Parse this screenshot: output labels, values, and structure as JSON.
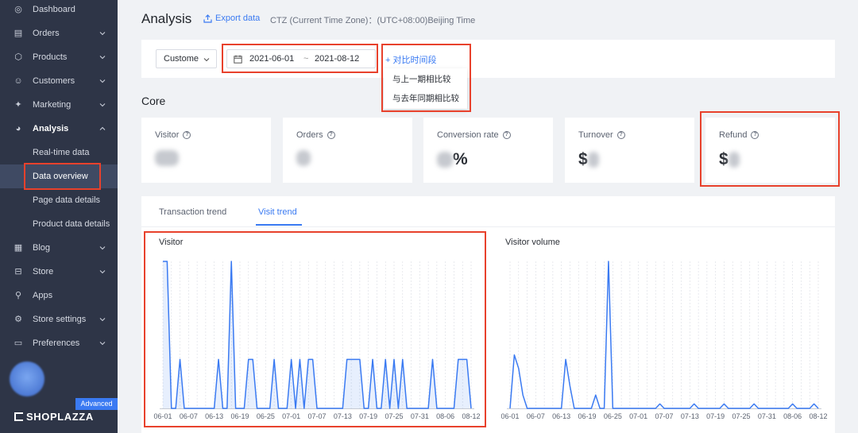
{
  "sidebar": {
    "items": [
      {
        "label": "Dashboard",
        "icon": "dashboard-icon",
        "has_chevron": false
      },
      {
        "label": "Orders",
        "icon": "orders-icon",
        "has_chevron": true
      },
      {
        "label": "Products",
        "icon": "products-icon",
        "has_chevron": true
      },
      {
        "label": "Customers",
        "icon": "customers-icon",
        "has_chevron": true
      },
      {
        "label": "Marketing",
        "icon": "marketing-icon",
        "has_chevron": true
      },
      {
        "label": "Analysis",
        "icon": "analysis-icon",
        "has_chevron": true,
        "expanded": true
      },
      {
        "label": "Blog",
        "icon": "blog-icon",
        "has_chevron": true
      },
      {
        "label": "Store",
        "icon": "store-icon",
        "has_chevron": true
      },
      {
        "label": "Apps",
        "icon": "apps-icon",
        "has_chevron": false
      },
      {
        "label": "Store settings",
        "icon": "gear-icon",
        "has_chevron": true
      },
      {
        "label": "Preferences",
        "icon": "preferences-icon",
        "has_chevron": true
      }
    ],
    "analysis_sub": [
      "Real-time data",
      "Data overview",
      "Page data details",
      "Product data details"
    ],
    "selected_sub": "Data overview",
    "badge": "Advanced",
    "logo": "SHOPLAZZA"
  },
  "header": {
    "title": "Analysis",
    "export_label": "Export data",
    "timezone": "CTZ (Current Time Zone)：(UTC+08:00)Beijing Time"
  },
  "filter": {
    "select_value": "Custome",
    "date_start": "2021-06-01",
    "date_sep": "~",
    "date_end": "2021-08-12",
    "compare_label": "+ 对比时间段",
    "compare_options": [
      "与上一期相比较",
      "与去年同期相比较"
    ]
  },
  "core": {
    "title": "Core",
    "metrics": [
      {
        "label": "Visitor",
        "prefix": "",
        "suffix": ""
      },
      {
        "label": "Orders",
        "prefix": "",
        "suffix": ""
      },
      {
        "label": "Conversion rate",
        "prefix": "",
        "suffix": "%"
      },
      {
        "label": "Turnover",
        "prefix": "$",
        "suffix": ""
      },
      {
        "label": "Refund",
        "prefix": "$",
        "suffix": ""
      }
    ]
  },
  "tabs": [
    {
      "label": "Transaction trend",
      "active": false
    },
    {
      "label": "Visit trend",
      "active": true
    }
  ],
  "chart_data": [
    {
      "type": "area",
      "title": "Visitor",
      "x": [
        "06-01",
        "06-02",
        "06-03",
        "06-04",
        "06-05",
        "06-06",
        "06-07",
        "06-08",
        "06-09",
        "06-10",
        "06-11",
        "06-12",
        "06-13",
        "06-14",
        "06-15",
        "06-16",
        "06-17",
        "06-18",
        "06-19",
        "06-20",
        "06-21",
        "06-22",
        "06-23",
        "06-24",
        "06-25",
        "06-26",
        "06-27",
        "06-28",
        "06-29",
        "06-30",
        "07-01",
        "07-02",
        "07-03",
        "07-04",
        "07-05",
        "07-06",
        "07-07",
        "07-08",
        "07-09",
        "07-10",
        "07-11",
        "07-12",
        "07-13",
        "07-14",
        "07-15",
        "07-16",
        "07-17",
        "07-18",
        "07-19",
        "07-20",
        "07-21",
        "07-22",
        "07-23",
        "07-24",
        "07-25",
        "07-26",
        "07-27",
        "07-28",
        "07-29",
        "07-30",
        "07-31",
        "08-01",
        "08-02",
        "08-03",
        "08-04",
        "08-05",
        "08-06",
        "08-07",
        "08-08",
        "08-09",
        "08-10",
        "08-11",
        "08-12"
      ],
      "tick_labels": [
        "06-01",
        "06-07",
        "06-13",
        "06-19",
        "06-25",
        "07-01",
        "07-07",
        "07-13",
        "07-19",
        "07-25",
        "07-31",
        "08-06",
        "08-12"
      ],
      "series": [
        {
          "values": [
            3,
            3,
            0,
            0,
            1,
            0,
            0,
            0,
            0,
            0,
            0,
            0,
            0,
            1,
            0,
            0,
            3,
            0,
            0,
            0,
            1,
            1,
            0,
            0,
            0,
            0,
            1,
            0,
            0,
            0,
            1,
            0,
            1,
            0,
            1,
            1,
            0,
            0,
            0,
            0,
            0,
            0,
            0,
            1,
            1,
            1,
            1,
            0,
            0,
            1,
            0,
            0,
            1,
            0,
            1,
            0,
            1,
            0,
            0,
            0,
            0,
            0,
            0,
            1,
            0,
            0,
            0,
            0,
            0,
            1,
            1,
            1,
            0
          ]
        }
      ],
      "grid": true
    },
    {
      "type": "line",
      "title": "Visitor volume",
      "x": [
        "06-01",
        "06-02",
        "06-03",
        "06-04",
        "06-05",
        "06-06",
        "06-07",
        "06-08",
        "06-09",
        "06-10",
        "06-11",
        "06-12",
        "06-13",
        "06-14",
        "06-15",
        "06-16",
        "06-17",
        "06-18",
        "06-19",
        "06-20",
        "06-21",
        "06-22",
        "06-23",
        "06-24",
        "06-25",
        "06-26",
        "06-27",
        "06-28",
        "06-29",
        "06-30",
        "07-01",
        "07-02",
        "07-03",
        "07-04",
        "07-05",
        "07-06",
        "07-07",
        "07-08",
        "07-09",
        "07-10",
        "07-11",
        "07-12",
        "07-13",
        "07-14",
        "07-15",
        "07-16",
        "07-17",
        "07-18",
        "07-19",
        "07-20",
        "07-21",
        "07-22",
        "07-23",
        "07-24",
        "07-25",
        "07-26",
        "07-27",
        "07-28",
        "07-29",
        "07-30",
        "07-31",
        "08-01",
        "08-02",
        "08-03",
        "08-04",
        "08-05",
        "08-06",
        "08-07",
        "08-08",
        "08-09",
        "08-10",
        "08-11",
        "08-12"
      ],
      "tick_labels": [
        "06-01",
        "06-07",
        "06-13",
        "06-19",
        "06-25",
        "07-01",
        "07-07",
        "07-13",
        "07-19",
        "07-25",
        "07-31",
        "08-06",
        "08-12"
      ],
      "series": [
        {
          "values": [
            0,
            12,
            9,
            3,
            0,
            0,
            0,
            0,
            0,
            0,
            0,
            0,
            0,
            11,
            5,
            0,
            0,
            0,
            0,
            0,
            3,
            0,
            0,
            33,
            0,
            0,
            0,
            0,
            0,
            0,
            0,
            0,
            0,
            0,
            0,
            1,
            0,
            0,
            0,
            0,
            0,
            0,
            0,
            1,
            0,
            0,
            0,
            0,
            0,
            0,
            1,
            0,
            0,
            0,
            0,
            0,
            0,
            1,
            0,
            0,
            0,
            0,
            0,
            0,
            0,
            0,
            1,
            0,
            0,
            0,
            0,
            1,
            0
          ]
        }
      ],
      "grid": true
    }
  ],
  "colors": {
    "accent": "#3a7af2",
    "highlight": "#e8412c",
    "sidebar": "#2e3547"
  }
}
